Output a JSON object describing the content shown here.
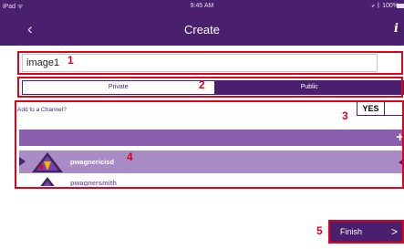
{
  "status_bar": {
    "carrier": "iPad ᯤ",
    "time": "9:45 AM",
    "battery": "⇗ ᛒ 100%"
  },
  "nav": {
    "back": "‹",
    "title": "Create",
    "info": "i"
  },
  "name_field": {
    "value": "image1"
  },
  "visibility": {
    "options": [
      "Private",
      "Public"
    ],
    "selected": "Public"
  },
  "channel": {
    "prompt": "Add to a Channel?",
    "toggle_yes": "YES",
    "add": "+",
    "rows": [
      {
        "name": "pwagnericisd"
      },
      {
        "name": "pwagnersmith"
      }
    ]
  },
  "finish": {
    "label": "Finish",
    "chevron": ">"
  },
  "callouts": [
    "1",
    "2",
    "3",
    "4",
    "5"
  ],
  "colors": {
    "brand": "#4a1f6e",
    "accent": "#8b5fad",
    "highlight_row": "#a98bc5",
    "callout_red": "#e2001a"
  }
}
